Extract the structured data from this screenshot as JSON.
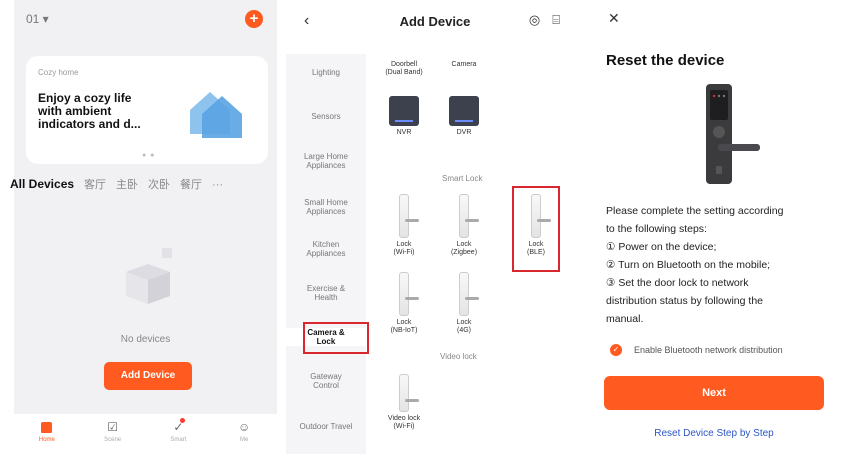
{
  "home": {
    "home_selector": "01 ▾",
    "plus_label": "+",
    "banner": {
      "small": "Cozy home",
      "title": "Enjoy a cozy life\nwith ambient\nindicators and d...",
      "dots": "● ●"
    },
    "rooms": [
      "All Devices",
      "客厅",
      "主卧",
      "次卧",
      "餐厅",
      "···"
    ],
    "empty_text": "No devices",
    "add_button": "Add Device",
    "tabs": [
      {
        "label": "Home",
        "icon": "home-icon"
      },
      {
        "label": "Scene",
        "icon": "scene-icon"
      },
      {
        "label": "Smart",
        "icon": "smart-icon"
      },
      {
        "label": "Me",
        "icon": "me-icon"
      }
    ]
  },
  "add_device": {
    "back": "‹",
    "title": "Add Device",
    "scan_icon": "◎",
    "qr_icon": "⌸",
    "categories": [
      "Lighting",
      "Sensors",
      "Large Home\nAppliances",
      "Small Home\nAppliances",
      "Kitchen\nAppliances",
      "Exercise &\nHealth",
      "Camera &\nLock",
      "Gateway\nControl",
      "Outdoor Travel"
    ],
    "sections": {
      "smart_lock": "Smart Lock",
      "video_lock": "Video lock"
    },
    "devices": {
      "doorbell": "Doorbell\n(Dual Band)",
      "camera": "Camera",
      "nvr": "NVR",
      "dvr": "DVR",
      "lock_wifi": "Lock\n(Wi-Fi)",
      "lock_zigbee": "Lock\n(Zigbee)",
      "lock_ble": "Lock\n(BLE)",
      "lock_nbiot": "Lock\n(NB-IoT)",
      "lock_4g": "Lock\n(4G)",
      "video_lock": "Video lock\n(Wi-Fi)"
    }
  },
  "reset": {
    "close": "✕",
    "title": "Reset the device",
    "lines": [
      "Please complete the setting according",
      "to the following steps:",
      "① Power on the device;",
      "② Turn on Bluetooth on the mobile;",
      "③ Set the door lock to network",
      "distribution status by following the",
      "manual."
    ],
    "checkbox_label": "Enable Bluetooth network distribution",
    "next": "Next",
    "step_link": "Reset Device Step by Step"
  },
  "colors": {
    "accent": "#ff5a1f",
    "highlight_box": "#d8272d",
    "link": "#2b56c6"
  }
}
